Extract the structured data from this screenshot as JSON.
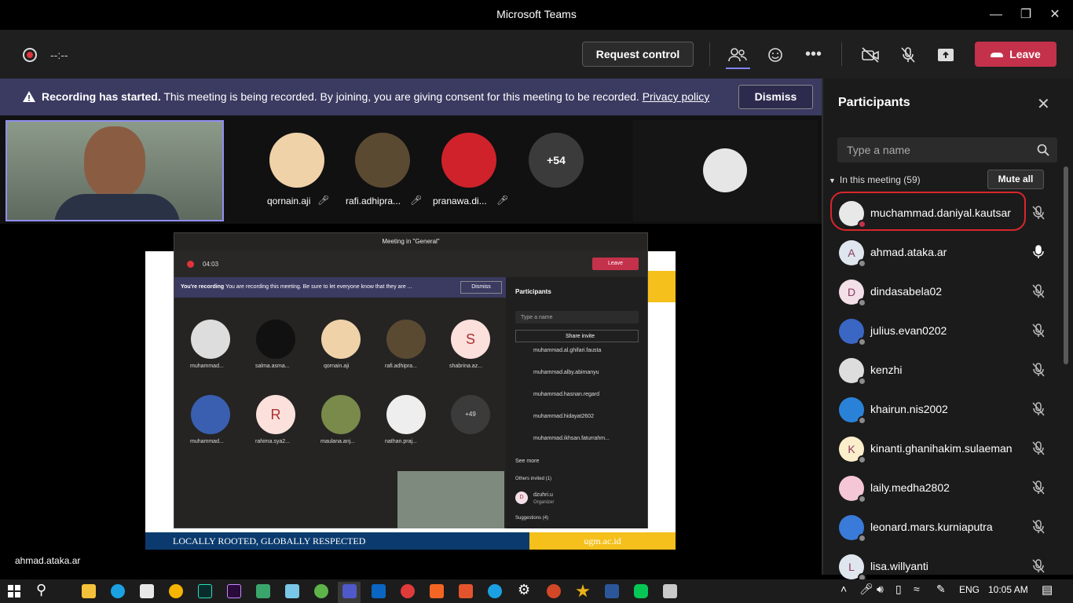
{
  "window": {
    "title": "Microsoft Teams"
  },
  "toolbar": {
    "timer": "--:--",
    "request_control": "Request control",
    "leave": "Leave"
  },
  "banner": {
    "strong": "Recording has started.",
    "text": " This meeting is being recorded. By joining, you are giving consent for this meeting to be recorded. ",
    "link": "Privacy policy",
    "dismiss": "Dismiss"
  },
  "strip": {
    "participants": [
      {
        "name": "qornain.aji",
        "color": "#f0d2a8"
      },
      {
        "name": "rafi.adhipra...",
        "color": "#5b4a32"
      },
      {
        "name": "pranawa.di...",
        "color": "#d0222b"
      }
    ],
    "more": "+54"
  },
  "shared": {
    "window_title": "Meeting in \"General\"",
    "timer": "04:03",
    "leave": "Leave",
    "rec_strong": "You're recording",
    "rec_text": "You are recording this meeting. Be sure to let everyone know that they are ...",
    "dismiss": "Dismiss",
    "grid": [
      {
        "name": "muhammad...",
        "letter": "",
        "color": "#ddd"
      },
      {
        "name": "salma.asma...",
        "letter": "",
        "color": "#111"
      },
      {
        "name": "qornain.aji",
        "letter": "",
        "color": "#f0d2a8"
      },
      {
        "name": "rafi.adhipra...",
        "letter": "",
        "color": "#5b4a32"
      },
      {
        "name": "shabrina.az...",
        "letter": "S",
        "color": "#fbe0dc"
      },
      {
        "name": "muhammad...",
        "letter": "",
        "color": "#3a5fb0"
      },
      {
        "name": "rahima.sya2...",
        "letter": "R",
        "color": "#fbe0dc"
      },
      {
        "name": "maulana.anj...",
        "letter": "",
        "color": "#7a8a4a"
      },
      {
        "name": "nathan.praj...",
        "letter": "",
        "color": "#eee"
      },
      {
        "name": "",
        "letter": "+49",
        "color": "#3b3b3b"
      }
    ],
    "panel_title": "Participants",
    "search_placeholder": "Type a name",
    "share_invite": "Share invite",
    "list": [
      "muhammad.al.ghifari.fausta",
      "muhammad.alby.abimanyu",
      "muhammad.hasnan.regard",
      "muhammad.hidayat2602",
      "muhammad.ikhsan.faturrahm..."
    ],
    "see_more": "See more",
    "others_invited": "Others invited (1)",
    "invitee": "dzuhri.u",
    "invitee_role": "Organizer",
    "suggestions": "Suggestions (4)",
    "footer_left": "LOCALLY ROOTED, GLOBALLY RESPECTED",
    "footer_right": "ugm.ac.id"
  },
  "stage": {
    "speaker_name": "ahmad.ataka.ar"
  },
  "panel": {
    "title": "Participants",
    "search_placeholder": "Type a name",
    "in_meeting": "In this meeting (59)",
    "mute_all": "Mute all",
    "people": [
      {
        "name": "muchammad.daniyal.kautsar",
        "initial": "",
        "av": "#e8e8e8",
        "status": "#c4314b",
        "mic": "muted"
      },
      {
        "name": "ahmad.ataka.ar",
        "initial": "A",
        "av": "#dfe6ee",
        "status": "#8a8a8a",
        "mic": "on"
      },
      {
        "name": "dindasabela02",
        "initial": "D",
        "av": "#f3dfe8",
        "status": "#8a8a8a",
        "mic": "muted"
      },
      {
        "name": "julius.evan0202",
        "initial": "",
        "av": "#3a66c4",
        "status": "#8a8a8a",
        "mic": "muted"
      },
      {
        "name": "kenzhi",
        "initial": "",
        "av": "#dddddd",
        "status": "#8a8a8a",
        "mic": "muted"
      },
      {
        "name": "khairun.nis2002",
        "initial": "",
        "av": "#2a82d8",
        "status": "#8a8a8a",
        "mic": "muted"
      },
      {
        "name": "kinanti.ghanihakim.sulaeman",
        "initial": "K",
        "av": "#fbeecb",
        "status": "#8a8a8a",
        "mic": "muted"
      },
      {
        "name": "laily.medha2802",
        "initial": "",
        "av": "#f5c6d6",
        "status": "#8a8a8a",
        "mic": "muted"
      },
      {
        "name": "leonard.mars.kurniaputra",
        "initial": "",
        "av": "#3a7ad8",
        "status": "#8a8a8a",
        "mic": "muted"
      },
      {
        "name": "lisa.willyanti",
        "initial": "L",
        "av": "#dfe6ee",
        "status": "#8a8a8a",
        "mic": "muted"
      }
    ]
  },
  "taskbar": {
    "lang": "ENG",
    "time": "10:05 AM"
  }
}
